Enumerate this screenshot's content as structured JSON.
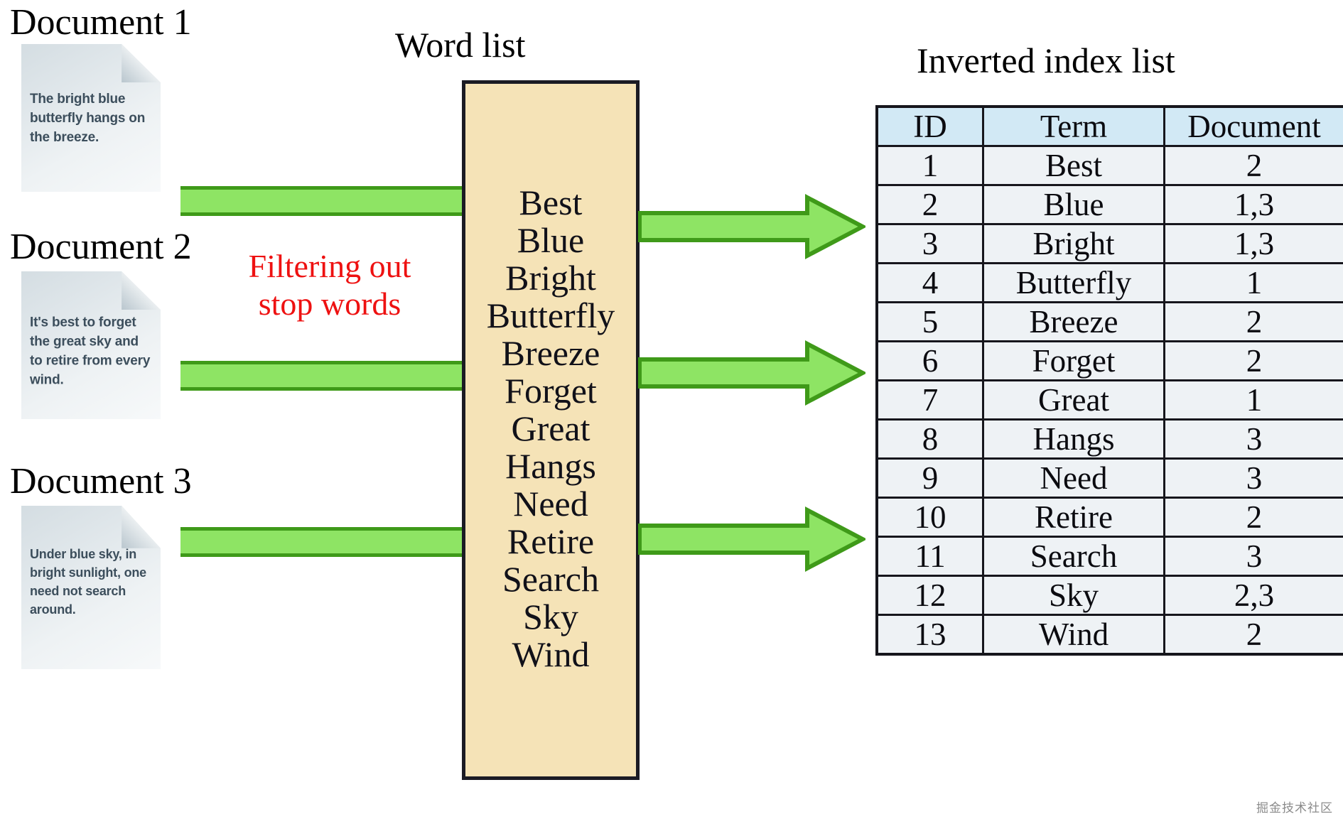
{
  "documents": [
    {
      "label": "Document 1",
      "text": "The bright blue butterfly hangs on the breeze."
    },
    {
      "label": "Document 2",
      "text": "It's best to forget the great sky and to retire from every wind."
    },
    {
      "label": "Document 3",
      "text": "Under blue sky, in bright sunlight, one need not search around."
    }
  ],
  "filter_note": {
    "line1": "Filtering out",
    "line2": "stop words"
  },
  "word_list": {
    "title": "Word list",
    "items": [
      "Best",
      "Blue",
      "Bright",
      "Butterfly",
      "Breeze",
      "Forget",
      "Great",
      "Hangs",
      "Need",
      "Retire",
      "Search",
      "Sky",
      "Wind"
    ]
  },
  "inverted_index": {
    "title": "Inverted index list",
    "columns": [
      "ID",
      "Term",
      "Document"
    ],
    "rows": [
      {
        "id": "1",
        "term": "Best",
        "document": "2"
      },
      {
        "id": "2",
        "term": "Blue",
        "document": "1,3"
      },
      {
        "id": "3",
        "term": "Bright",
        "document": "1,3"
      },
      {
        "id": "4",
        "term": "Butterfly",
        "document": "1"
      },
      {
        "id": "5",
        "term": "Breeze",
        "document": "2"
      },
      {
        "id": "6",
        "term": "Forget",
        "document": "2"
      },
      {
        "id": "7",
        "term": "Great",
        "document": "1"
      },
      {
        "id": "8",
        "term": "Hangs",
        "document": "3"
      },
      {
        "id": "9",
        "term": "Need",
        "document": "3"
      },
      {
        "id": "10",
        "term": "Retire",
        "document": "2"
      },
      {
        "id": "11",
        "term": "Search",
        "document": "3"
      },
      {
        "id": "12",
        "term": "Sky",
        "document": "2,3"
      },
      {
        "id": "13",
        "term": "Wind",
        "document": "2"
      }
    ]
  },
  "colors": {
    "arrow_fill": "#8ee464",
    "arrow_stroke": "#3f9a19",
    "word_list_fill": "#f5e3b7",
    "table_header_fill": "#d2e9f5",
    "table_body_fill": "#eef2f5",
    "filter_note_color": "#ee1111"
  },
  "watermark": "掘金技术社区"
}
